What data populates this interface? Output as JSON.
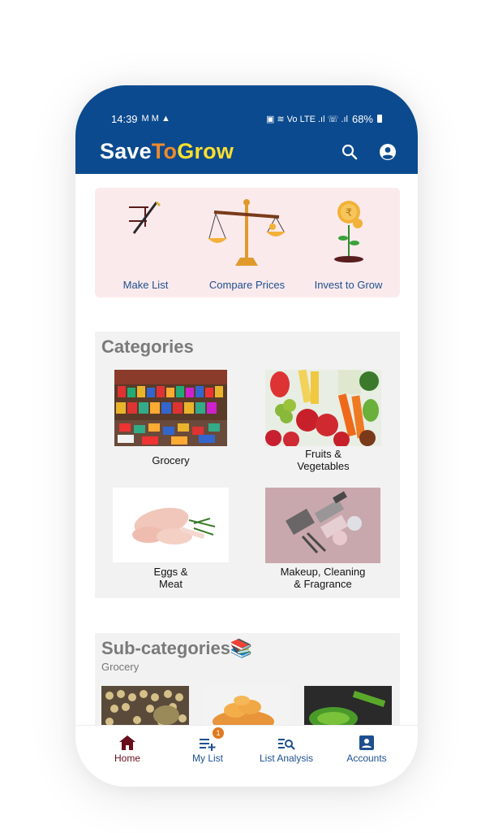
{
  "status_bar": {
    "time": "14:39",
    "left_glyphs": "M M ▲",
    "right_glyphs": "▣ ≋ Vo LTE .ıl ☏ .ıl",
    "battery": "68%"
  },
  "app": {
    "brand_part1": "Save",
    "brand_part2": "To",
    "brand_part3": "Grow"
  },
  "hero": {
    "items": [
      {
        "label": "Make List",
        "icon": "pen-list-icon"
      },
      {
        "label": "Compare Prices",
        "icon": "scale-icon"
      },
      {
        "label": "Invest to Grow",
        "icon": "coin-plant-icon"
      }
    ]
  },
  "categories": {
    "title": "Categories",
    "items": [
      {
        "label": "Grocery"
      },
      {
        "label": "Fruits &\nVegetables"
      },
      {
        "label": "Eggs &\nMeat"
      },
      {
        "label": "Makeup, Cleaning\n& Fragrance"
      }
    ]
  },
  "subcategories": {
    "title": "Sub-categories📚",
    "selected_category": "Grocery"
  },
  "bottom_nav": {
    "items": [
      {
        "label": "Home",
        "icon": "home-icon",
        "active": true
      },
      {
        "label": "My List",
        "icon": "playlist-add-icon",
        "badge": "1"
      },
      {
        "label": "List Analysis",
        "icon": "list-search-icon"
      },
      {
        "label": "Accounts",
        "icon": "account-box-icon"
      }
    ]
  },
  "colors": {
    "primary": "#0b4a8e",
    "accent_orange": "#f0892c",
    "accent_yellow": "#ffde2e",
    "hero_bg": "#fbeaec",
    "active_nav": "#6a0d1a"
  }
}
